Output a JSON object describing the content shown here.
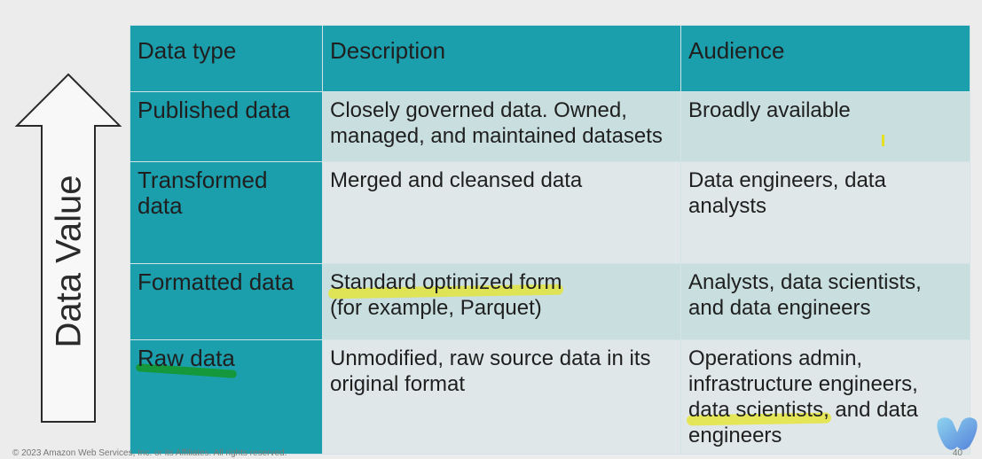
{
  "slide": {
    "axis_label": "Data Value",
    "footer_copyright": "© 2023 Amazon Web Services, Inc. or its Affiliates. All rights reserved.",
    "page_number": "40"
  },
  "table": {
    "headers": [
      "Data type",
      "Description",
      "Audience"
    ],
    "rows": [
      {
        "type": "Published data",
        "description": "Closely governed data. Owned, managed, and maintained datasets",
        "audience": "Broadly available"
      },
      {
        "type": "Transformed data",
        "description": "Merged and cleansed data",
        "audience": "Data engineers, data analysts"
      },
      {
        "type": "Formatted data",
        "description_highlight": "Standard optimized form",
        "description_rest": "(for example, Parquet)",
        "audience": "Analysts, data scientists, and data engineers"
      },
      {
        "type": "Raw data",
        "description": "Unmodified, raw source data in its original format",
        "audience_before": "Operations admin, infrastructure engineers,",
        "audience_highlight": "data scientists,",
        "audience_after": "and data engineers"
      }
    ]
  },
  "colors": {
    "header_teal": "#1b9fad",
    "row_light_1": "#c8dedf",
    "row_light_2": "#dfe7e8",
    "highlight_yellow": "#e6e628",
    "highlight_green": "#149628"
  }
}
